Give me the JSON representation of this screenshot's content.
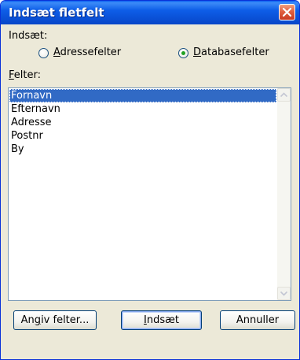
{
  "window": {
    "title": "Indsæt fletfelt"
  },
  "insert_group": {
    "label": "Indsæt:",
    "options": [
      {
        "label_rest": "dressefelter",
        "mnemonic": "A",
        "checked": false
      },
      {
        "label_rest": "atabasefelter",
        "mnemonic": "D",
        "checked": true
      }
    ]
  },
  "fields": {
    "label_rest": "elter:",
    "mnemonic": "F",
    "items": [
      "Fornavn",
      "Efternavn",
      "Adresse",
      "Postnr",
      "By"
    ],
    "selected_index": 0
  },
  "buttons": {
    "specify": {
      "pre": "An",
      "mnemonic": "g",
      "post": "iv felter..."
    },
    "insert": {
      "mnemonic": "I",
      "rest": "ndsæt"
    },
    "cancel": {
      "label": "Annuller"
    }
  },
  "colors": {
    "titlebar": "#0a52d8",
    "close": "#e06040",
    "selection": "#316ac5",
    "dialog_bg": "#ece9d8"
  }
}
